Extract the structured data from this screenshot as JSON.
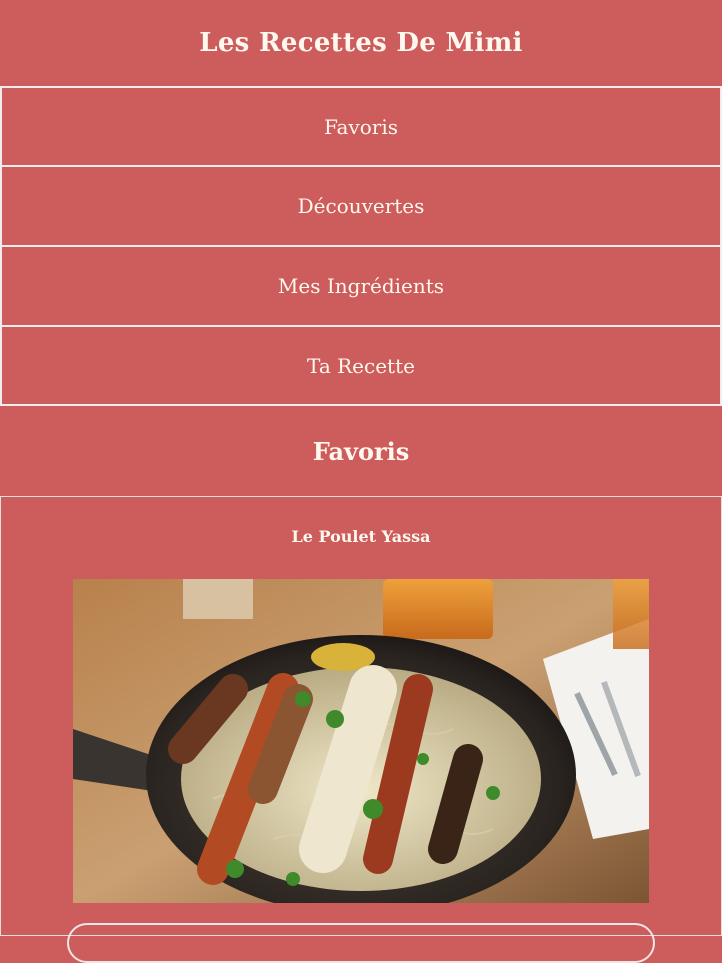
{
  "app": {
    "title": "Les Recettes De Mimi"
  },
  "nav": [
    {
      "label": "Favoris"
    },
    {
      "label": "Découvertes"
    },
    {
      "label": "Mes Ingrédients"
    },
    {
      "label": "Ta Recette"
    }
  ],
  "section": {
    "title": "Favoris"
  },
  "recipe": {
    "title": "Le Poulet Yassa"
  },
  "colors": {
    "background": "#cd5c5c",
    "text": "#fff8ee",
    "border": "#f2ecee"
  }
}
